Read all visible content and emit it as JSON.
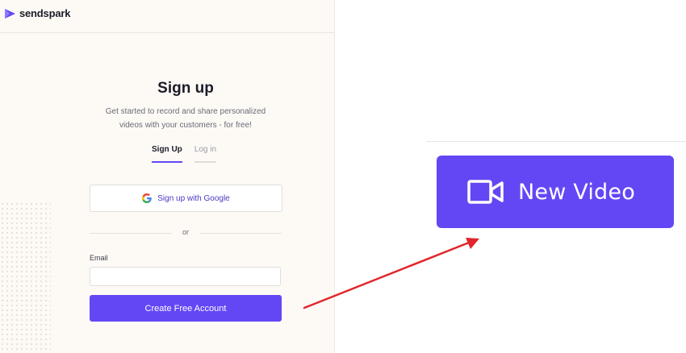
{
  "brand": {
    "name": "sendspark",
    "color": "#6347f5"
  },
  "signup": {
    "title": "Sign up",
    "subtitle_line1": "Get started to record and share personalized",
    "subtitle_line2": "videos with your customers - for free!",
    "tabs": [
      {
        "label": "Sign Up",
        "active": true
      },
      {
        "label": "Log in",
        "active": false
      }
    ],
    "google_button_label": "Sign up with Google",
    "google_icon": "google-g-icon",
    "divider_text": "or",
    "email_label": "Email",
    "email_value": "",
    "email_placeholder": "",
    "submit_label": "Create Free Account"
  },
  "callout": {
    "button_label": "New Video",
    "icon": "video-camera-icon",
    "arrow_color": "#e0262b"
  }
}
